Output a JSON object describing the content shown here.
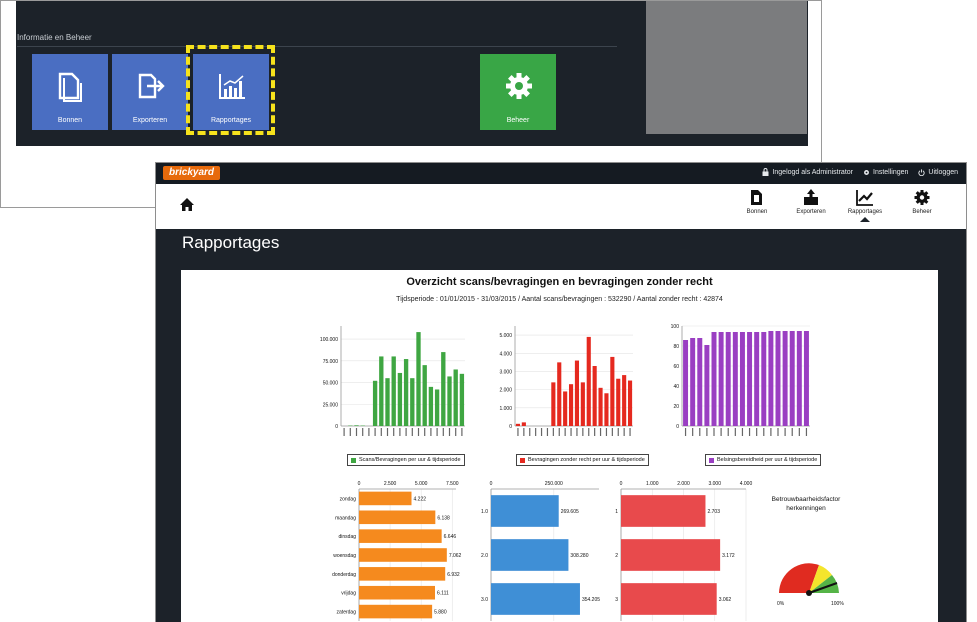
{
  "back": {
    "section_title": "Informatie en Beheer",
    "tiles": [
      {
        "label": "Bonnen",
        "icon": "document-icon"
      },
      {
        "label": "Exporteren",
        "icon": "export-icon"
      },
      {
        "label": "Rapportages",
        "icon": "bar-chart-icon"
      },
      {
        "label": "Beheer",
        "icon": "gear-icon"
      }
    ],
    "colors": {
      "tile_blue": "#4a6ec2",
      "tile_green": "#39a646",
      "highlight": "#f6e21c"
    }
  },
  "front": {
    "logo": "brickyard",
    "topbar": {
      "logged_in": "Ingelogd als Administrator",
      "settings": "Instellingen",
      "logout": "Uitloggen"
    },
    "nav": [
      {
        "label": "Bonnen",
        "icon": "document-icon"
      },
      {
        "label": "Exporteren",
        "icon": "upload-icon"
      },
      {
        "label": "Rapportages",
        "icon": "trend-icon",
        "active": true
      },
      {
        "label": "Beheer",
        "icon": "gear-icon"
      }
    ],
    "page_title": "Rapportages",
    "report_title": "Overzicht scans/bevragingen en bevragingen zonder recht",
    "report_subtitle": "Tijdsperiode : 01/01/2015 - 31/03/2015  / Aantal scans/bevragingen : 532290  / Aantal zonder recht : 42874"
  },
  "chart_data": [
    {
      "type": "bar",
      "legend": "Scans/Bevragingen per uur & tijdsperiode",
      "color": "#3fa642",
      "ylim": [
        0,
        115000
      ],
      "yticks": [
        "0",
        "25.000",
        "50.000",
        "75.000",
        "100.000"
      ],
      "ytick_values": [
        0,
        25000,
        50000,
        75000,
        100000
      ],
      "values": [
        0,
        500,
        800,
        500,
        0,
        52000,
        80000,
        55000,
        80000,
        61000,
        77000,
        55000,
        108000,
        70000,
        45000,
        42000,
        85000,
        57000,
        65000,
        60000
      ]
    },
    {
      "type": "bar",
      "legend": "Bevragingen zonder recht per uur & tijdsperiode",
      "color": "#e5291f",
      "ylim": [
        0,
        5500
      ],
      "yticks": [
        "0",
        "1.000",
        "2.000",
        "3.000",
        "4.000",
        "5.000"
      ],
      "ytick_values": [
        0,
        1000,
        2000,
        3000,
        4000,
        5000
      ],
      "values": [
        120,
        200,
        0,
        0,
        0,
        0,
        2400,
        3500,
        1900,
        2300,
        3600,
        2400,
        4900,
        3300,
        2100,
        1800,
        3800,
        2600,
        2800,
        2500
      ]
    },
    {
      "type": "bar",
      "legend": "Belsingsbereidheid per uur & tijdsperiode",
      "color": "#9a3fc2",
      "ylim": [
        0,
        100
      ],
      "yticks": [
        "0",
        "20",
        "40",
        "60",
        "80",
        "100"
      ],
      "ytick_values": [
        0,
        20,
        40,
        60,
        80,
        100
      ],
      "values": [
        86,
        88,
        88,
        81,
        94,
        94,
        94,
        94,
        94,
        94,
        94,
        94,
        95,
        95,
        95,
        95,
        95,
        95
      ]
    },
    {
      "type": "bar",
      "orientation": "horizontal",
      "color": "#f58a1e",
      "xlim": [
        0,
        7800
      ],
      "xticks": [
        "0",
        "2.500",
        "5.000",
        "7.500"
      ],
      "xtick_values": [
        0,
        2500,
        5000,
        7500
      ],
      "categories": [
        "zondag",
        "maandag",
        "dinsdag",
        "woensdag",
        "donderdag",
        "vrijdag",
        "zaterdag"
      ],
      "values": [
        4222,
        6138,
        6646,
        7062,
        6932,
        6111,
        5880
      ],
      "labels": [
        "4.222",
        "6.138",
        "6.646",
        "7.062",
        "6.932",
        "6.111",
        "5.880"
      ]
    },
    {
      "type": "bar",
      "orientation": "horizontal",
      "color": "#3f8fd6",
      "xlim": [
        0,
        430000
      ],
      "xticks": [
        "0",
        "250.000"
      ],
      "xtick_values": [
        0,
        250000
      ],
      "categories": [
        "1.0",
        "2.0",
        "3.0"
      ],
      "values": [
        269605,
        308280,
        354205
      ],
      "labels": [
        "269.605",
        "308.280",
        "354.205"
      ]
    },
    {
      "type": "bar",
      "orientation": "horizontal",
      "color": "#e84a4c",
      "xlim": [
        0,
        4000
      ],
      "xticks": [
        "0",
        "1.000",
        "2.000",
        "3.000",
        "4.000"
      ],
      "xtick_values": [
        0,
        1000,
        2000,
        3000,
        4000
      ],
      "categories": [
        "1",
        "2",
        "3"
      ],
      "values": [
        2703,
        3172,
        3062
      ],
      "labels": [
        "2.703",
        "3.172",
        "3.062"
      ]
    }
  ],
  "gauge": {
    "title": "Betrouwbaarheidsfactor herkenningen",
    "min_label": "0%",
    "max_label": "100%"
  }
}
